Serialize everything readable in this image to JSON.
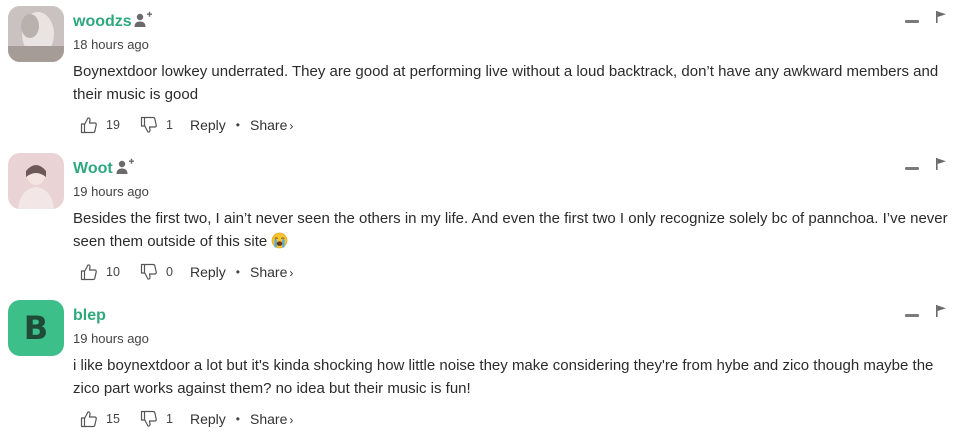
{
  "comments": [
    {
      "username": "woodzs",
      "username_color": "#2fa87e",
      "time": "18 hours ago",
      "text": "Boynextdoor lowkey underrated. They are good at performing live without a loud backtrack, don’t have any awkward members and their music is good",
      "likes": "19",
      "dislikes": "1",
      "reply_label": "Reply",
      "share_label": "Share",
      "avatar": "photo"
    },
    {
      "username": "Woot",
      "username_color": "#2fa87e",
      "time": "19 hours ago",
      "text": "Besides the first two, I ain’t never seen the others in my life. And even the first two I only recognize solely bc of pannchoa. I’ve never seen them outside of this site",
      "emoji": "crying-face-emoji",
      "likes": "10",
      "dislikes": "0",
      "reply_label": "Reply",
      "share_label": "Share",
      "avatar": "photo"
    },
    {
      "username": "blep",
      "username_color": "#2fa87e",
      "time": "19 hours ago",
      "text": "i like boynextdoor a lot but it's kinda shocking how little noise they make considering they're from hybe and zico though maybe the zico part works against them? no idea but their music is fun!",
      "likes": "15",
      "dislikes": "1",
      "reply_label": "Reply",
      "share_label": "Share",
      "avatar": "letter",
      "avatar_letter": "B",
      "avatar_color": "#3dbf8a"
    }
  ]
}
